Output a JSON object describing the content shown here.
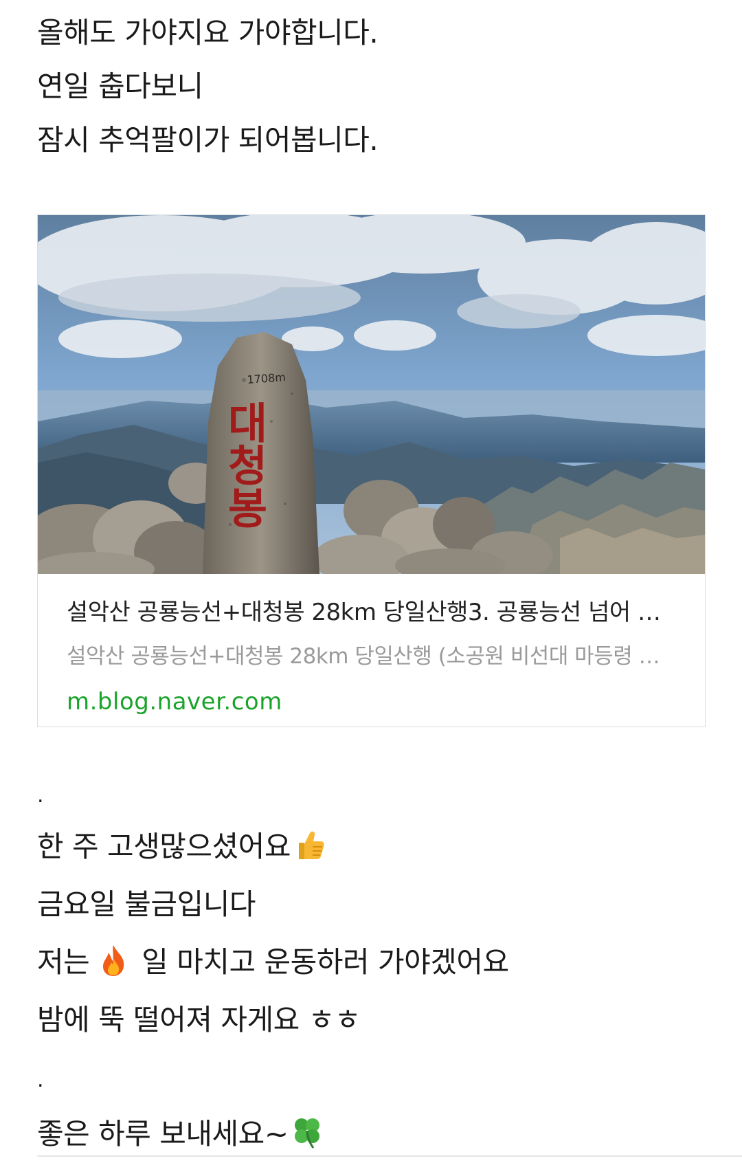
{
  "intro_lines": [
    "올해도 가야지요 가야합니다.",
    "연일 춥다보니",
    "잠시 추억팔이가 되어봅니다."
  ],
  "link_card": {
    "image_stone_text": "대청봉",
    "image_stone_small_text": "1708m",
    "title": "설악산 공룡능선+대청봉 28km 당일산행3. 공룡능선 넘어 설악산 천불동 계곡으로",
    "description": "설악산 공룡능선+대청봉 28km 당일산행 (소공원 비선대 마등령 공룡능선 대청봉)",
    "url": "m.blog.naver.com"
  },
  "separator_1": ".",
  "middle_lines": {
    "line1": "한 주 고생많으셨어요",
    "line2": "금요일 불금입니다",
    "line3_before": "저는",
    "line3_after": "일 마치고 운동하러 가야겠어요",
    "line4": "밤에 뚝 떨어져 자게요 ㅎㅎ"
  },
  "separator_2": ".",
  "closing_line": "좋은 하루 보내세요~",
  "emojis": {
    "thumbs_up": "thumbs-up",
    "fire": "fire",
    "clover": "four-leaf-clover"
  },
  "colors": {
    "text": "#1a1a1a",
    "url_green": "#1aa32a",
    "desc_gray": "#9a9a9a"
  }
}
